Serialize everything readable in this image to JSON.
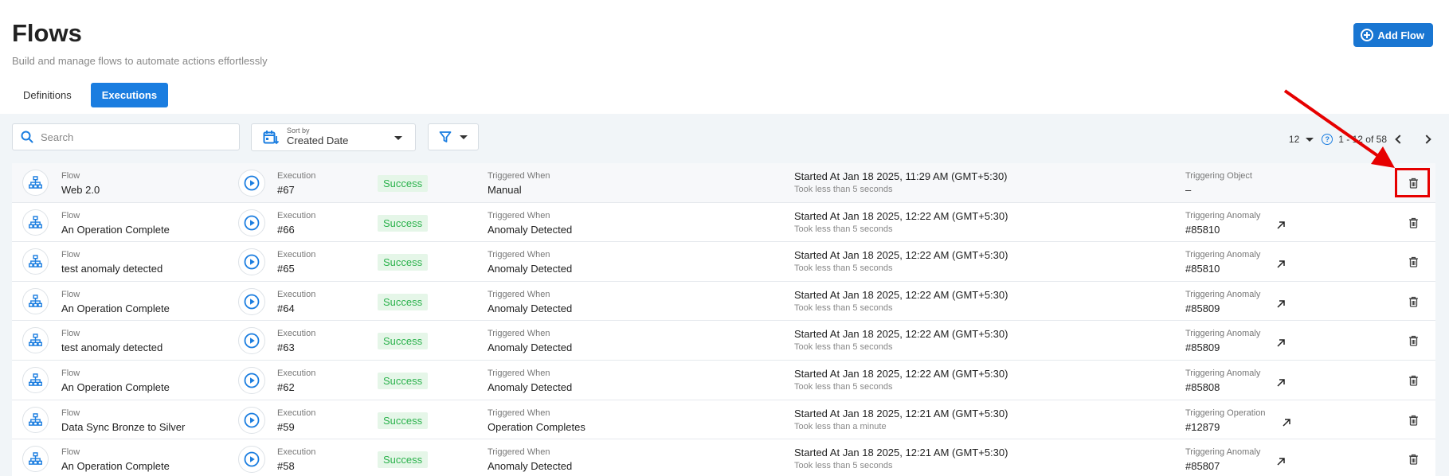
{
  "header": {
    "title": "Flows",
    "subtitle": "Build and manage flows to automate actions effortlessly",
    "add_button": "Add Flow"
  },
  "tabs": [
    {
      "label": "Definitions",
      "active": false
    },
    {
      "label": "Executions",
      "active": true
    }
  ],
  "toolbar": {
    "search_placeholder": "Search",
    "sort_label": "Sort by",
    "sort_value": "Created Date"
  },
  "pagination": {
    "page_size": "12",
    "range": "1 - 12 of 58"
  },
  "labels": {
    "flow": "Flow",
    "execution": "Execution"
  },
  "colors": {
    "primary": "#1a7de0",
    "success_text": "#2bb24c",
    "success_bg": "#e5f6e8",
    "annotation": "#e60000"
  },
  "rows": [
    {
      "flow": "Web 2.0",
      "execution": "#67",
      "status": "Success",
      "trigger_label": "Triggered When",
      "trigger_value": "Manual",
      "started": "Started At Jan 18 2025, 11:29 AM (GMT+5:30)",
      "took": "Took less than 5 seconds",
      "object_label": "Triggering Object",
      "object_value": "–",
      "has_link": false
    },
    {
      "flow": "An Operation Complete",
      "execution": "#66",
      "status": "Success",
      "trigger_label": "Triggered When",
      "trigger_value": "Anomaly Detected",
      "started": "Started At Jan 18 2025, 12:22 AM (GMT+5:30)",
      "took": "Took less than 5 seconds",
      "object_label": "Triggering Anomaly",
      "object_value": "#85810",
      "has_link": true
    },
    {
      "flow": "test anomaly detected",
      "execution": "#65",
      "status": "Success",
      "trigger_label": "Triggered When",
      "trigger_value": "Anomaly Detected",
      "started": "Started At Jan 18 2025, 12:22 AM (GMT+5:30)",
      "took": "Took less than 5 seconds",
      "object_label": "Triggering Anomaly",
      "object_value": "#85810",
      "has_link": true
    },
    {
      "flow": "An Operation Complete",
      "execution": "#64",
      "status": "Success",
      "trigger_label": "Triggered When",
      "trigger_value": "Anomaly Detected",
      "started": "Started At Jan 18 2025, 12:22 AM (GMT+5:30)",
      "took": "Took less than 5 seconds",
      "object_label": "Triggering Anomaly",
      "object_value": "#85809",
      "has_link": true
    },
    {
      "flow": "test anomaly detected",
      "execution": "#63",
      "status": "Success",
      "trigger_label": "Triggered When",
      "trigger_value": "Anomaly Detected",
      "started": "Started At Jan 18 2025, 12:22 AM (GMT+5:30)",
      "took": "Took less than 5 seconds",
      "object_label": "Triggering Anomaly",
      "object_value": "#85809",
      "has_link": true
    },
    {
      "flow": "An Operation Complete",
      "execution": "#62",
      "status": "Success",
      "trigger_label": "Triggered When",
      "trigger_value": "Anomaly Detected",
      "started": "Started At Jan 18 2025, 12:22 AM (GMT+5:30)",
      "took": "Took less than 5 seconds",
      "object_label": "Triggering Anomaly",
      "object_value": "#85808",
      "has_link": true
    },
    {
      "flow": "Data Sync Bronze to Silver",
      "execution": "#59",
      "status": "Success",
      "trigger_label": "Triggered When",
      "trigger_value": "Operation Completes",
      "started": "Started At Jan 18 2025, 12:21 AM (GMT+5:30)",
      "took": "Took less than a minute",
      "object_label": "Triggering Operation",
      "object_value": "#12879",
      "has_link": true
    },
    {
      "flow": "An Operation Complete",
      "execution": "#58",
      "status": "Success",
      "trigger_label": "Triggered When",
      "trigger_value": "Anomaly Detected",
      "started": "Started At Jan 18 2025, 12:21 AM (GMT+5:30)",
      "took": "Took less than 5 seconds",
      "object_label": "Triggering Anomaly",
      "object_value": "#85807",
      "has_link": true
    }
  ]
}
